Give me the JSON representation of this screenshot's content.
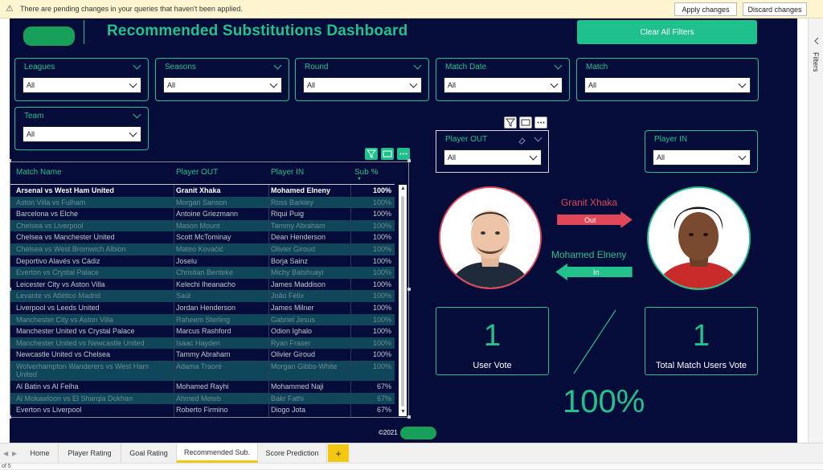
{
  "banner": {
    "message": "There are pending changes in your queries that haven't been applied.",
    "apply_label": "Apply changes",
    "discard_label": "Discard changes"
  },
  "header": {
    "title": "Recommended Substitutions Dashboard",
    "clear_filters_label": "Clear All Filters"
  },
  "slicers": [
    {
      "label": "Leagues",
      "value": "All"
    },
    {
      "label": "Seasons",
      "value": "All"
    },
    {
      "label": "Round",
      "value": "All"
    },
    {
      "label": "Match Date",
      "value": "All"
    },
    {
      "label": "Match",
      "value": "All"
    },
    {
      "label": "Team",
      "value": "All"
    }
  ],
  "player_out_slicer": {
    "label": "Player OUT",
    "value": "All"
  },
  "player_in_slicer": {
    "label": "Player IN",
    "value": "All"
  },
  "table": {
    "columns": [
      "Match Name",
      "Player OUT",
      "Player IN",
      "Sub %"
    ],
    "rows": [
      [
        "Arsenal vs West Ham United",
        "Granit Xhaka",
        "Mohamed Elneny",
        "100%"
      ],
      [
        "Aston Villa vs Fulham",
        "Morgan Sanson",
        "Ross Barkley",
        "100%"
      ],
      [
        "Barcelona vs Elche",
        "Antoine Griezmann",
        "Riqui Puig",
        "100%"
      ],
      [
        "Chelsea vs Liverpool",
        "Mason Mount",
        "Tammy Abraham",
        "100%"
      ],
      [
        "Chelsea vs Manchester United",
        "Scott McTominay",
        "Dean Henderson",
        "100%"
      ],
      [
        "Chelsea vs West Bromwich Albion",
        "Mateo Kovačić",
        "Olivier Giroud",
        "100%"
      ],
      [
        "Deportivo Alavés vs Cádiz",
        "Joselu",
        "Borja Sainz",
        "100%"
      ],
      [
        "Everton vs Crystal Palace",
        "Christian Benteke",
        "Michy Batshuayi",
        "100%"
      ],
      [
        "Leicester City vs Aston Villa",
        "Kelechi Iheanacho",
        "James Maddison",
        "100%"
      ],
      [
        "Levante vs Atlético Madrid",
        "Saúl",
        "João Félix",
        "100%"
      ],
      [
        "Liverpool vs Leeds United",
        "Jordan Henderson",
        "James Milner",
        "100%"
      ],
      [
        "Manchester City vs Aston Villa",
        "Raheem Sterling",
        "Gabriel Jesus",
        "100%"
      ],
      [
        "Manchester United vs Crystal Palace",
        "Marcus Rashford",
        "Odion Ighalo",
        "100%"
      ],
      [
        "Manchester United vs Newcastle United",
        "Isaac Hayden",
        "Ryan Fraser",
        "100%"
      ],
      [
        "Newcastle United vs Chelsea",
        "Tammy Abraham",
        "Olivier Giroud",
        "100%"
      ],
      [
        "Wolverhampton Wanderers vs West Ham United",
        "Adama Traoré",
        "Morgan Gibbs-White",
        "100%"
      ],
      [
        "Al Batin vs Al Feiha",
        "Mohamed Rayhi",
        "Mohammed Naji",
        "67%"
      ],
      [
        "Al Mokawloon vs El Sharqia Dokhan",
        "Ahmed Meteb",
        "Bakr Fathi",
        "67%"
      ],
      [
        "Everton vs Liverpool",
        "Roberto Firmino",
        "Diogo Jota",
        "67%"
      ]
    ]
  },
  "substitution": {
    "player_out": "Granit Xhaka",
    "out_label": "Out",
    "player_in": "Mohamed Elneny",
    "in_label": "In"
  },
  "cards": {
    "user_vote_value": "1",
    "user_vote_label": "User Vote",
    "total_value": "1",
    "total_label": "Total Match Users Vote",
    "percentage": "100%"
  },
  "footer": {
    "copyright": "©2021"
  },
  "right_pane": {
    "filters_label": "Filters"
  },
  "tabs": [
    "Home",
    "Player Rating",
    "Goal Rating",
    "Recommended Sub.",
    "Score Prediction"
  ],
  "status": {
    "page_text": "of 5"
  },
  "colors": {
    "accent": "#23c28d",
    "out_red": "#e0485a",
    "background": "#050c3a"
  }
}
